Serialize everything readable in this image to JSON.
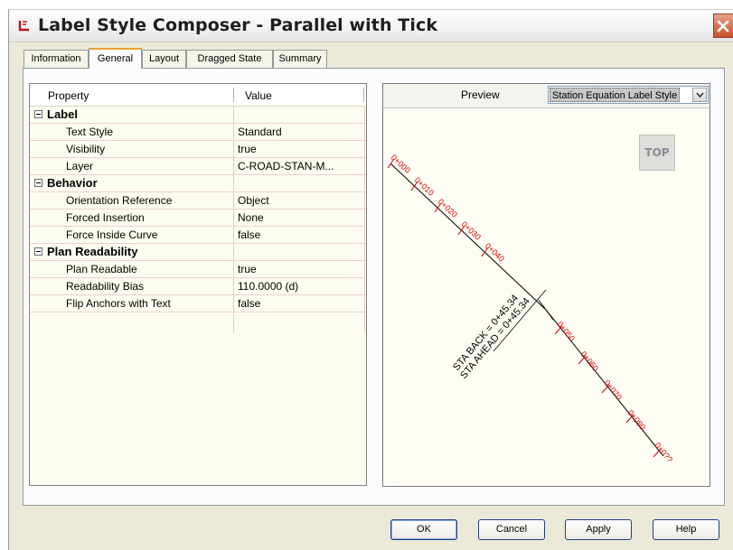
{
  "window": {
    "title": "Label Style Composer - Parallel with Tick"
  },
  "tabs": [
    {
      "label": "Information"
    },
    {
      "label": "General"
    },
    {
      "label": "Layout"
    },
    {
      "label": "Dragged State"
    },
    {
      "label": "Summary"
    }
  ],
  "active_tab": "General",
  "grid": {
    "header_property": "Property",
    "header_value": "Value",
    "rows": [
      {
        "type": "group",
        "property": "Label",
        "value": ""
      },
      {
        "type": "item",
        "property": "Text Style",
        "value": "Standard"
      },
      {
        "type": "item",
        "property": "Visibility",
        "value": "true"
      },
      {
        "type": "item",
        "property": "Layer",
        "value": "C-ROAD-STAN-M..."
      },
      {
        "type": "group",
        "property": "Behavior",
        "value": ""
      },
      {
        "type": "item",
        "property": "Orientation Reference",
        "value": "Object"
      },
      {
        "type": "item",
        "property": "Forced Insertion",
        "value": "None"
      },
      {
        "type": "item",
        "property": "Force Inside Curve",
        "value": "false"
      },
      {
        "type": "group",
        "property": "Plan Readability",
        "value": ""
      },
      {
        "type": "item",
        "property": "Plan Readable",
        "value": "true"
      },
      {
        "type": "item",
        "property": "Readability Bias",
        "value": "110.0000 (d)"
      },
      {
        "type": "item",
        "property": "Flip Anchors with Text",
        "value": "false"
      }
    ]
  },
  "preview": {
    "label": "Preview",
    "style_select": "Station Equation Label Style",
    "view_cube": "TOP",
    "station_labels": [
      "0+000",
      "0+010",
      "0+020",
      "0+030",
      "0+040",
      "0+050",
      "0+060",
      "0+070",
      "0+080",
      "0+0??"
    ],
    "equation_back": "STA BACK = 0+45.34",
    "equation_ahead": "STA AHEAD = 0+45.34",
    "colors": {
      "station_label": "#e00000",
      "alignment": "#000000"
    }
  },
  "buttons": {
    "ok": "OK",
    "cancel": "Cancel",
    "apply": "Apply",
    "help": "Help"
  }
}
